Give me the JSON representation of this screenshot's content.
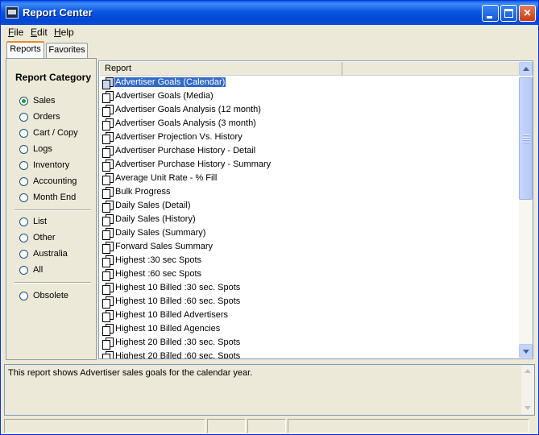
{
  "window": {
    "title": "Report Center",
    "controls": [
      "minimize",
      "maximize",
      "close"
    ]
  },
  "menu": {
    "items": [
      {
        "label": "File",
        "accel": "F",
        "rest": "ile"
      },
      {
        "label": "Edit",
        "accel": "E",
        "rest": "dit"
      },
      {
        "label": "Help",
        "accel": "H",
        "rest": "elp"
      }
    ]
  },
  "tabs": [
    {
      "label": "Reports",
      "active": true
    },
    {
      "label": "Favorites",
      "active": false
    }
  ],
  "category": {
    "title": "Report Category",
    "selected": "Sales",
    "groups": [
      [
        "Sales",
        "Orders",
        "Cart / Copy",
        "Logs",
        "Inventory",
        "Accounting",
        "Month End"
      ],
      [
        "List",
        "Other",
        "Australia",
        "All"
      ],
      [
        "Obsolete"
      ]
    ]
  },
  "report_list": {
    "column_header": "Report",
    "selected_index": 0,
    "items": [
      "Advertiser Goals (Calendar)",
      "Advertiser Goals (Media)",
      "Advertiser Goals Analysis (12 month)",
      "Advertiser Goals Analysis (3 month)",
      "Advertiser Projection Vs. History",
      "Advertiser Purchase History - Detail",
      "Advertiser Purchase History - Summary",
      "Average Unit Rate - % Fill",
      "Bulk Progress",
      "Daily Sales (Detail)",
      "Daily Sales (History)",
      "Daily Sales (Summary)",
      "Forward Sales Summary",
      "Highest :30 sec Spots",
      "Highest :60 sec Spots",
      "Highest 10 Billed :30 sec. Spots",
      "Highest 10 Billed :60 sec. Spots",
      "Highest 10 Billed Advertisers",
      "Highest 10 Billed Agencies",
      "Highest 20 Billed :30 sec. Spots",
      "Highest 20 Billed :60 sec. Spots"
    ]
  },
  "description": {
    "text": "This report shows Advertiser sales goals for the calendar year."
  },
  "colors": {
    "titlebar": "#0054e3",
    "selection": "#316ac5",
    "window_bg": "#ece9d8",
    "radio_dot": "#21a121"
  }
}
